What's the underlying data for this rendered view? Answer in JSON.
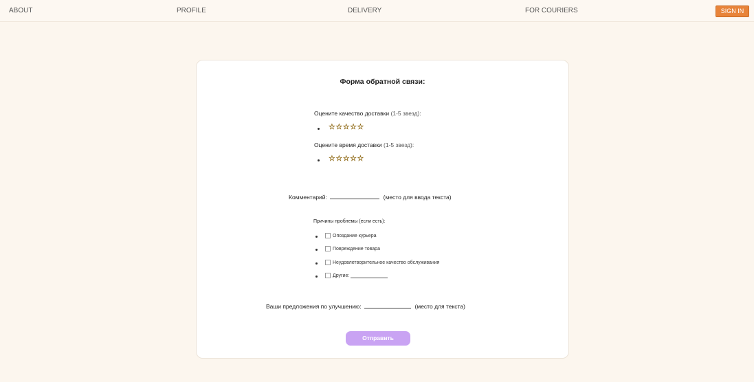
{
  "nav": {
    "about": "ABOUT",
    "profile": "PROFILE",
    "delivery": "DELIVERY",
    "couriers": "FOR COURIERS",
    "signin": "SIGN IN"
  },
  "colors": {
    "background": "#fcf6ee",
    "signin_bg": "#e8843a",
    "submit_bg": "#c9a3f3",
    "star": "#e9b322"
  },
  "form": {
    "title": "Форма обратной связи:",
    "quality": {
      "label": "Оцените качество доставки",
      "hint": "(1-5 звезд):",
      "stars": "☆☆☆☆☆",
      "rating_scale": 5
    },
    "time": {
      "label": "Оцените время доставки",
      "hint": "(1-5 звезд):",
      "stars": "☆☆☆☆☆",
      "rating_scale": 5
    },
    "comment": {
      "label": "Комментарий:",
      "hint": "(место для ввода текста)"
    },
    "reasons": {
      "title": "Причины проблемы (если есть):",
      "items": [
        "Опоздание курьера",
        "Повреждение товара",
        "Неудовлетворительное качество обслуживания",
        "Другие:"
      ]
    },
    "suggestions": {
      "label": "Ваши предложения по улучшению:",
      "hint": "(место для текста)"
    },
    "submit": "Отправить"
  }
}
